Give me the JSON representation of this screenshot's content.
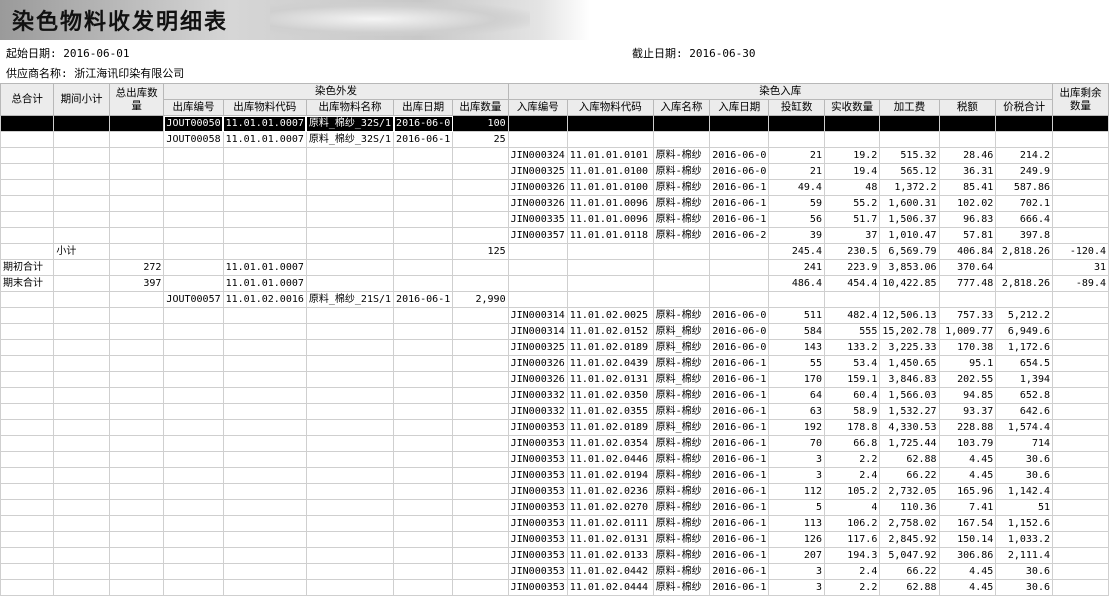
{
  "report": {
    "title": "染色物料收发明细表",
    "start_label": "起始日期:",
    "start_value": "2016-06-01",
    "end_label": "截止日期:",
    "end_value": "2016-06-30",
    "supplier_label": "供应商名称:",
    "supplier_value": "浙江海讯印染有限公司"
  },
  "headers": {
    "total": "总合计",
    "period_subtotal": "期间小计",
    "total_out_qty": "总出库数量",
    "group_out": "染色外发",
    "group_in": "染色入库",
    "remaining": "出库剩余数量",
    "out_cols": [
      "出库编号",
      "出库物料代码",
      "出库物料名称",
      "出库日期",
      "出库数量"
    ],
    "in_cols": [
      "入库编号",
      "入库物料代码",
      "入库名称",
      "入库日期",
      "投缸数",
      "实收数量",
      "加工费",
      "税额",
      "价税合计"
    ]
  },
  "rows": [
    [
      "",
      "",
      "",
      "JOUT00050",
      "11.01.01.0007",
      "原料_棉纱_32S/1",
      "2016-06-0",
      "100",
      "",
      "",
      "",
      "",
      "",
      "",
      "",
      "",
      "",
      ""
    ],
    [
      "",
      "",
      "",
      "JOUT00058",
      "11.01.01.0007",
      "原料_棉纱_32S/1",
      "2016-06-1",
      "25",
      "",
      "",
      "",
      "",
      "",
      "",
      "",
      "",
      "",
      ""
    ],
    [
      "",
      "",
      "",
      "",
      "",
      "",
      "",
      "",
      "JIN000324",
      "11.01.01.0101",
      "原料-棉纱",
      "2016-06-0",
      "21",
      "19.2",
      "515.32",
      "28.46",
      "214.2",
      ""
    ],
    [
      "",
      "",
      "",
      "",
      "",
      "",
      "",
      "",
      "JIN000325",
      "11.01.01.0100",
      "原料-棉纱",
      "2016-06-0",
      "21",
      "19.4",
      "565.12",
      "36.31",
      "249.9",
      ""
    ],
    [
      "",
      "",
      "",
      "",
      "",
      "",
      "",
      "",
      "JIN000326",
      "11.01.01.0100",
      "原料-棉纱",
      "2016-06-1",
      "49.4",
      "48",
      "1,372.2",
      "85.41",
      "587.86",
      ""
    ],
    [
      "",
      "",
      "",
      "",
      "",
      "",
      "",
      "",
      "JIN000326",
      "11.01.01.0096",
      "原料-棉纱",
      "2016-06-1",
      "59",
      "55.2",
      "1,600.31",
      "102.02",
      "702.1",
      ""
    ],
    [
      "",
      "",
      "",
      "",
      "",
      "",
      "",
      "",
      "JIN000335",
      "11.01.01.0096",
      "原料-棉纱",
      "2016-06-1",
      "56",
      "51.7",
      "1,506.37",
      "96.83",
      "666.4",
      ""
    ],
    [
      "",
      "",
      "",
      "",
      "",
      "",
      "",
      "",
      "JIN000357",
      "11.01.01.0118",
      "原料-棉纱",
      "2016-06-2",
      "39",
      "37",
      "1,010.47",
      "57.81",
      "397.8",
      ""
    ],
    [
      "",
      "小计",
      "",
      "",
      "",
      "",
      "",
      "125",
      "",
      "",
      "",
      "",
      "245.4",
      "230.5",
      "6,569.79",
      "406.84",
      "2,818.26",
      "-120.4"
    ],
    [
      "期初合计",
      "",
      "272",
      "",
      "11.01.01.0007",
      "",
      "",
      "",
      "",
      "",
      "",
      "",
      "241",
      "223.9",
      "3,853.06",
      "370.64",
      "",
      "31"
    ],
    [
      "期末合计",
      "",
      "397",
      "",
      "11.01.01.0007",
      "",
      "",
      "",
      "",
      "",
      "",
      "",
      "486.4",
      "454.4",
      "10,422.85",
      "777.48",
      "2,818.26",
      "-89.4"
    ],
    [
      "",
      "",
      "",
      "JOUT00057",
      "11.01.02.0016",
      "原料_棉纱_21S/1",
      "2016-06-1",
      "2,990",
      "",
      "",
      "",
      "",
      "",
      "",
      "",
      "",
      "",
      ""
    ],
    [
      "",
      "",
      "",
      "",
      "",
      "",
      "",
      "",
      "JIN000314",
      "11.01.02.0025",
      "原料-棉纱",
      "2016-06-0",
      "511",
      "482.4",
      "12,506.13",
      "757.33",
      "5,212.2",
      ""
    ],
    [
      "",
      "",
      "",
      "",
      "",
      "",
      "",
      "",
      "JIN000314",
      "11.01.02.0152",
      "原料_棉纱",
      "2016-06-0",
      "584",
      "555",
      "15,202.78",
      "1,009.77",
      "6,949.6",
      ""
    ],
    [
      "",
      "",
      "",
      "",
      "",
      "",
      "",
      "",
      "JIN000325",
      "11.01.02.0189",
      "原料_棉纱",
      "2016-06-0",
      "143",
      "133.2",
      "3,225.33",
      "170.38",
      "1,172.6",
      ""
    ],
    [
      "",
      "",
      "",
      "",
      "",
      "",
      "",
      "",
      "JIN000326",
      "11.01.02.0439",
      "原料-棉纱",
      "2016-06-1",
      "55",
      "53.4",
      "1,450.65",
      "95.1",
      "654.5",
      ""
    ],
    [
      "",
      "",
      "",
      "",
      "",
      "",
      "",
      "",
      "JIN000326",
      "11.01.02.0131",
      "原料_棉纱",
      "2016-06-1",
      "170",
      "159.1",
      "3,846.83",
      "202.55",
      "1,394",
      ""
    ],
    [
      "",
      "",
      "",
      "",
      "",
      "",
      "",
      "",
      "JIN000332",
      "11.01.02.0350",
      "原料-棉纱",
      "2016-06-1",
      "64",
      "60.4",
      "1,566.03",
      "94.85",
      "652.8",
      ""
    ],
    [
      "",
      "",
      "",
      "",
      "",
      "",
      "",
      "",
      "JIN000332",
      "11.01.02.0355",
      "原料-棉纱",
      "2016-06-1",
      "63",
      "58.9",
      "1,532.27",
      "93.37",
      "642.6",
      ""
    ],
    [
      "",
      "",
      "",
      "",
      "",
      "",
      "",
      "",
      "JIN000353",
      "11.01.02.0189",
      "原料_棉纱",
      "2016-06-1",
      "192",
      "178.8",
      "4,330.53",
      "228.88",
      "1,574.4",
      ""
    ],
    [
      "",
      "",
      "",
      "",
      "",
      "",
      "",
      "",
      "JIN000353",
      "11.01.02.0354",
      "原料-棉纱",
      "2016-06-1",
      "70",
      "66.8",
      "1,725.44",
      "103.79",
      "714",
      ""
    ],
    [
      "",
      "",
      "",
      "",
      "",
      "",
      "",
      "",
      "JIN000353",
      "11.01.02.0446",
      "原料-棉纱",
      "2016-06-1",
      "3",
      "2.2",
      "62.88",
      "4.45",
      "30.6",
      ""
    ],
    [
      "",
      "",
      "",
      "",
      "",
      "",
      "",
      "",
      "JIN000353",
      "11.01.02.0194",
      "原料-棉纱",
      "2016-06-1",
      "3",
      "2.4",
      "66.22",
      "4.45",
      "30.6",
      ""
    ],
    [
      "",
      "",
      "",
      "",
      "",
      "",
      "",
      "",
      "JIN000353",
      "11.01.02.0236",
      "原料-棉纱",
      "2016-06-1",
      "112",
      "105.2",
      "2,732.05",
      "165.96",
      "1,142.4",
      ""
    ],
    [
      "",
      "",
      "",
      "",
      "",
      "",
      "",
      "",
      "JIN000353",
      "11.01.02.0270",
      "原料-棉纱",
      "2016-06-1",
      "5",
      "4",
      "110.36",
      "7.41",
      "51",
      ""
    ],
    [
      "",
      "",
      "",
      "",
      "",
      "",
      "",
      "",
      "JIN000353",
      "11.01.02.0111",
      "原料-棉纱",
      "2016-06-1",
      "113",
      "106.2",
      "2,758.02",
      "167.54",
      "1,152.6",
      ""
    ],
    [
      "",
      "",
      "",
      "",
      "",
      "",
      "",
      "",
      "JIN000353",
      "11.01.02.0131",
      "原料-棉纱",
      "2016-06-1",
      "126",
      "117.6",
      "2,845.92",
      "150.14",
      "1,033.2",
      ""
    ],
    [
      "",
      "",
      "",
      "",
      "",
      "",
      "",
      "",
      "JIN000353",
      "11.01.02.0133",
      "原料-棉纱",
      "2016-06-1",
      "207",
      "194.3",
      "5,047.92",
      "306.86",
      "2,111.4",
      ""
    ],
    [
      "",
      "",
      "",
      "",
      "",
      "",
      "",
      "",
      "JIN000353",
      "11.01.02.0442",
      "原料-棉纱",
      "2016-06-1",
      "3",
      "2.4",
      "66.22",
      "4.45",
      "30.6",
      ""
    ],
    [
      "",
      "",
      "",
      "",
      "",
      "",
      "",
      "",
      "JIN000353",
      "11.01.02.0444",
      "原料-棉纱",
      "2016-06-1",
      "3",
      "2.2",
      "62.88",
      "4.45",
      "30.6",
      ""
    ]
  ]
}
